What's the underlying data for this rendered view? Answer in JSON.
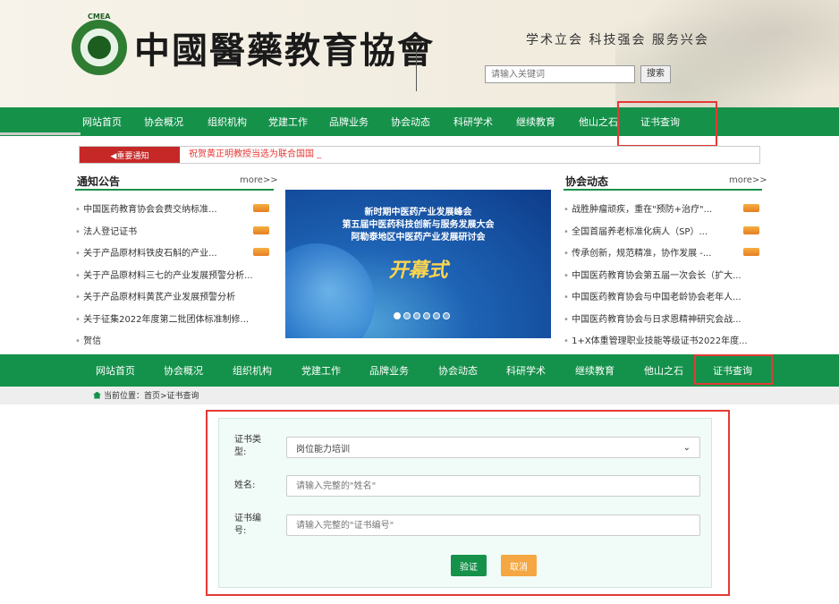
{
  "header": {
    "emblem_tag": "CMEA",
    "logo_text": "中國醫藥教育協會",
    "slogan": "学术立会 科技强会 服务兴会",
    "search_placeholder": "请输入关键词",
    "search_button": "搜索"
  },
  "nav": {
    "items": [
      "网站首页",
      "协会概况",
      "组织机构",
      "党建工作",
      "品牌业务",
      "协会动态",
      "科研学术",
      "继续教育",
      "他山之石",
      "证书查询"
    ]
  },
  "notice": {
    "tag": "◀重要通知",
    "text": "祝贺黄正明教授当选为联合国国 _"
  },
  "announcements": {
    "title": "通知公告",
    "more": "more>>",
    "items": [
      {
        "text": "中国医药教育协会会费交纳标准...",
        "hot": true
      },
      {
        "text": "法人登记证书",
        "hot": true
      },
      {
        "text": "关于产品原材料铁皮石斛的产业...",
        "hot": true
      },
      {
        "text": "关于产品原材料三七的产业发展预警分析...",
        "hot": false
      },
      {
        "text": "关于产品原材料黄芪产业发展预警分析",
        "hot": false
      },
      {
        "text": "关于征集2022年度第二批团体标准制修...",
        "hot": false
      },
      {
        "text": "贺信",
        "hot": false
      }
    ]
  },
  "banner": {
    "line1": "新时期中医药产业发展峰会",
    "line2": "第五届中医药科技创新与服务发展大会",
    "line3": "阿勒泰地区中医药产业发展研讨会",
    "kaimushi": "开幕式"
  },
  "news": {
    "title": "协会动态",
    "more": "more>>",
    "items": [
      {
        "text": "战胜肿瘤顽疾，重在\"预防+治疗\"...",
        "hot": true
      },
      {
        "text": "全国首届养老标准化病人（SP）...",
        "hot": true
      },
      {
        "text": "传承创新，规范精准，协作发展 -...",
        "hot": true
      },
      {
        "text": "中国医药教育协会第五届一次会长（扩大...",
        "hot": false
      },
      {
        "text": "中国医药教育协会与中国老龄协会老年人...",
        "hot": false
      },
      {
        "text": "中国医药教育协会与日求恩精神研究会战...",
        "hot": false
      },
      {
        "text": "1+X体重管理职业技能等级证书2022年度...",
        "hot": false
      }
    ]
  },
  "breadcrumb": "当前位置：首页>证书查询",
  "form": {
    "type_label": "证书类型:",
    "type_value": "岗位能力培训",
    "name_label": "姓名:",
    "name_placeholder": "请输入完整的\"姓名\"",
    "number_label": "证书编号:",
    "number_placeholder": "请输入完整的\"证书编号\"",
    "verify_button": "验证",
    "cancel_button": "取消"
  },
  "colors": {
    "nav_green": "#15914a",
    "highlight_red": "#e53935",
    "cancel_orange": "#f4a742"
  }
}
